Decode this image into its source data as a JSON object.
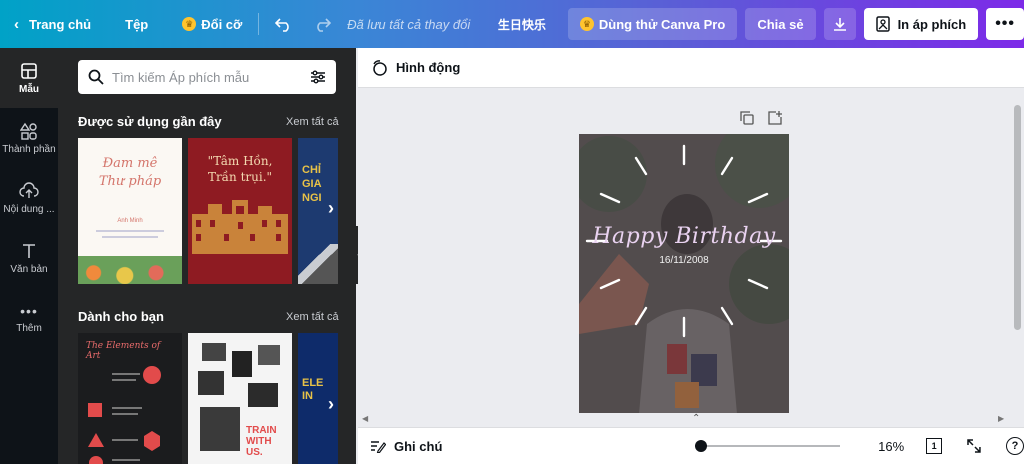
{
  "topbar": {
    "home_label": "Trang chủ",
    "file_label": "Tệp",
    "resize_label": "Đổi cỡ",
    "status": "Đã lưu tất cả thay đổi",
    "doc_title": "生日快乐",
    "try_pro_label": "Dùng thử Canva Pro",
    "share_label": "Chia sẻ",
    "print_label": "In áp phích"
  },
  "rail": {
    "items": [
      {
        "label": "Mẫu"
      },
      {
        "label": "Thành phần"
      },
      {
        "label": "Nội dung ..."
      },
      {
        "label": "Văn bản"
      },
      {
        "label": "Thêm"
      }
    ]
  },
  "panel": {
    "search_placeholder": "Tìm kiếm Áp phích mẫu",
    "recent_title": "Được sử dụng gần đây",
    "for_you_title": "Dành cho bạn",
    "see_all": "Xem tất cả",
    "recent_templates": [
      {
        "line1": "Đam mê",
        "line2": "Thư pháp",
        "name": "Anh Minh"
      },
      {
        "line1": "\"Tâm Hồn,",
        "line2": "Trần trụi.\""
      },
      {
        "line1": "CHỈ",
        "line2": "GIA",
        "line3": "NGI"
      }
    ],
    "for_you_templates": [
      {
        "title": "The Elements of Art"
      },
      {
        "title": "TRAIN WITH US."
      },
      {
        "title": "ELE IN"
      }
    ]
  },
  "canvas": {
    "animate_label": "Hình động",
    "poster_title": "Happy Birthday",
    "poster_date": "16/11/2008"
  },
  "bottombar": {
    "notes_label": "Ghi chú",
    "zoom_value": "16%",
    "zoom_fraction": 0.0,
    "page_count": "1",
    "help": "?"
  },
  "colors": {
    "gradient_start": "#00a2c7",
    "gradient_end": "#7d2ae8",
    "rail_bg": "#0e1318",
    "panel_bg": "#252627",
    "crown": "#ffc42e"
  }
}
